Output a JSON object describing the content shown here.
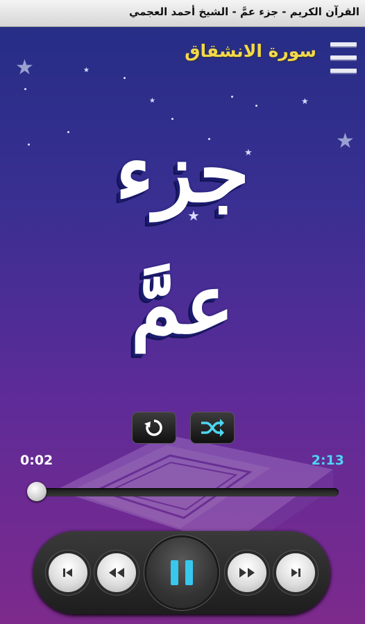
{
  "window": {
    "title": "القرآن الكريم - جزء عمَّ - الشيخ أحمد العجمي"
  },
  "header": {
    "surah_title": "سورة الانشقاق",
    "menu_icon": "hamburger-menu-icon"
  },
  "artwork": {
    "line1": "جزء",
    "line2": "عمَّ"
  },
  "controls": {
    "repeat_icon": "repeat-icon",
    "shuffle_icon": "shuffle-icon"
  },
  "progress": {
    "current_time": "0:02",
    "total_time": "2:13",
    "position_fraction": 0.015
  },
  "player": {
    "buttons": [
      "skip-previous-icon",
      "rewind-icon",
      "pause-icon",
      "fast-forward-icon",
      "skip-next-icon"
    ]
  },
  "colors": {
    "accent": "#4fd6f2",
    "surah_title": "#f3d94a"
  }
}
